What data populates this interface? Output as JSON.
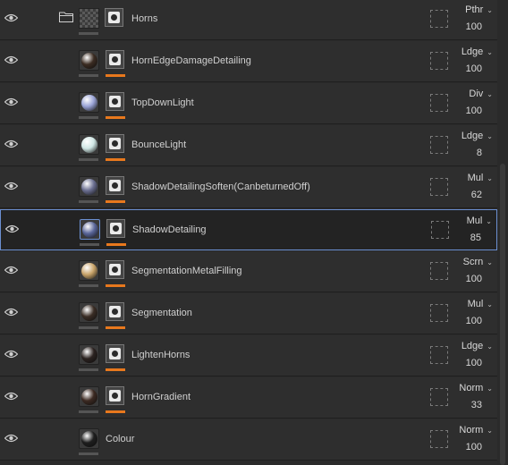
{
  "accent_color": "#e8781d",
  "selection_color": "#6b8fd1",
  "layers": [
    {
      "name": "Horns",
      "mode": "Pthr",
      "opacity": "100",
      "type": "folder",
      "eye_icon": "eye-icon",
      "folder_icon": "folder-icon",
      "selected": false
    },
    {
      "name": "HornEdgeDamageDetailing",
      "mode": "Ldge",
      "opacity": "100",
      "ball": "#3b2c22",
      "selected": false
    },
    {
      "name": "TopDownLight",
      "mode": "Div",
      "opacity": "100",
      "ball": "#9aa3d6",
      "selected": false
    },
    {
      "name": "BounceLight",
      "mode": "Ldge",
      "opacity": "8",
      "ball": "#cfe6e4",
      "selected": false
    },
    {
      "name": "ShadowDetailingSoften(CanbeturnedOff)",
      "mode": "Mul",
      "opacity": "62",
      "ball": "#6b6f91",
      "selected": false
    },
    {
      "name": "ShadowDetailing",
      "mode": "Mul",
      "opacity": "85",
      "ball": "#5a6699",
      "selected": true
    },
    {
      "name": "SegmentationMetalFilling",
      "mode": "Scrn",
      "opacity": "100",
      "ball": "#c9a46a",
      "selected": false
    },
    {
      "name": "Segmentation",
      "mode": "Mul",
      "opacity": "100",
      "ball": "#3a2d25",
      "selected": false
    },
    {
      "name": "LightenHorns",
      "mode": "Ldge",
      "opacity": "100",
      "ball": "#2b2220",
      "selected": false
    },
    {
      "name": "HornGradient",
      "mode": "Norm",
      "opacity": "33",
      "ball": "#3c2a22",
      "selected": false
    },
    {
      "name": "Colour",
      "mode": "Norm",
      "opacity": "100",
      "ball": "#1e1e1e",
      "selected": false
    }
  ]
}
